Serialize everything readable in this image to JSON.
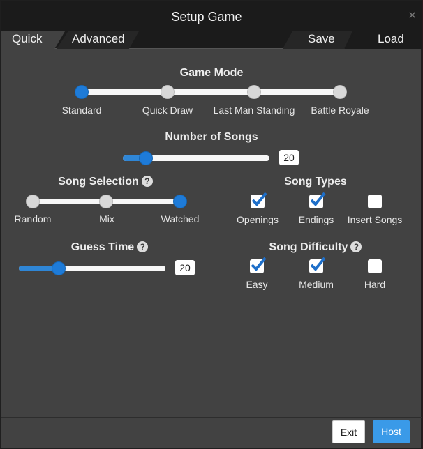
{
  "window": {
    "title": "Setup Game",
    "close_glyph": "✕"
  },
  "tabs": {
    "quick": "Quick",
    "advanced": "Advanced",
    "save": "Save",
    "load": "Load"
  },
  "game_mode": {
    "title": "Game Mode",
    "options": [
      "Standard",
      "Quick Draw",
      "Last Man Standing",
      "Battle Royale"
    ],
    "selected": "Standard"
  },
  "number_of_songs": {
    "title": "Number of Songs",
    "value": "20",
    "min": 5,
    "max": 100
  },
  "song_selection": {
    "title": "Song Selection",
    "help": "?",
    "options": [
      "Random",
      "Mix",
      "Watched"
    ],
    "selected": "Watched"
  },
  "song_types": {
    "title": "Song Types",
    "items": [
      {
        "label": "Openings",
        "checked": true
      },
      {
        "label": "Endings",
        "checked": true
      },
      {
        "label": "Insert Songs",
        "checked": false
      }
    ]
  },
  "guess_time": {
    "title": "Guess Time",
    "help": "?",
    "value": "20",
    "min": 5,
    "max": 60
  },
  "song_difficulty": {
    "title": "Song Difficulty",
    "help": "?",
    "items": [
      {
        "label": "Easy",
        "checked": true
      },
      {
        "label": "Medium",
        "checked": true
      },
      {
        "label": "Hard",
        "checked": false
      }
    ]
  },
  "footer": {
    "exit": "Exit",
    "host": "Host"
  },
  "colors": {
    "accent": "#2f86d6",
    "host_button": "#3a9ae8",
    "modal_bg": "#424242",
    "header_bg": "#1b1b1b"
  }
}
